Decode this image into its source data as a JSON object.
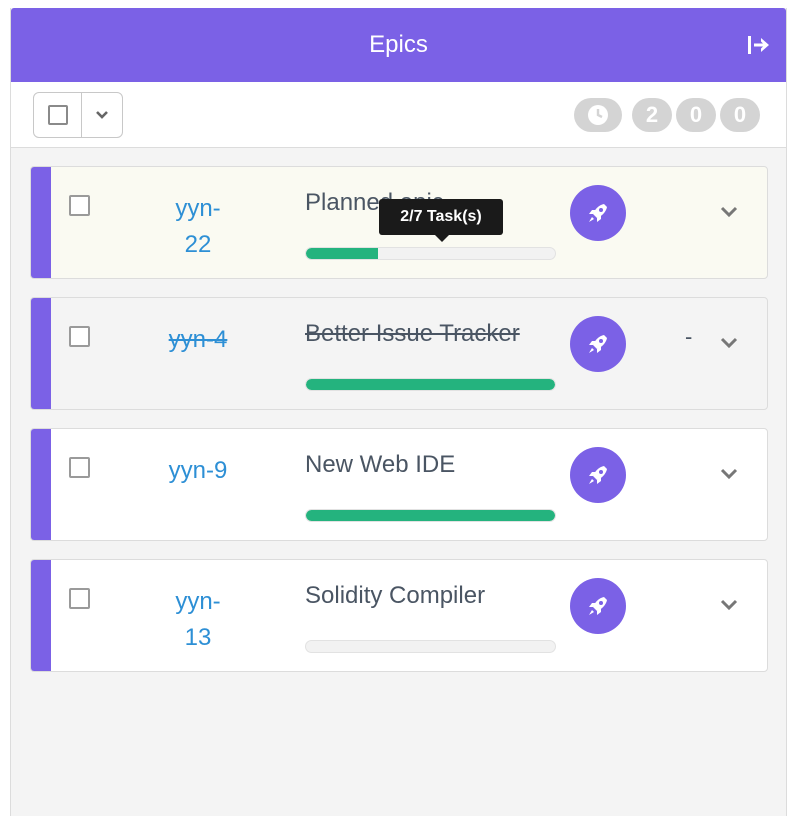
{
  "header": {
    "title": "Epics",
    "exit_icon": "sign-out-icon"
  },
  "toolbar": {
    "counters": [
      "2",
      "0",
      "0"
    ],
    "clock_icon": "clock-icon"
  },
  "tooltip": {
    "text": "2/7 Task(s)"
  },
  "epics": [
    {
      "key": "yyn-22",
      "title": "Planned epic",
      "progress": 0.29,
      "done": false,
      "highlight": true,
      "dash": ""
    },
    {
      "key": "yyn-4",
      "title": "Better Issue Tracker",
      "progress": 1.0,
      "done": true,
      "highlight": false,
      "dash": "-"
    },
    {
      "key": "yyn-9",
      "title": "New Web IDE",
      "progress": 1.0,
      "done": false,
      "highlight": false,
      "dash": ""
    },
    {
      "key": "yyn-13",
      "title": "Solidity Compiler",
      "progress": 0.0,
      "done": false,
      "highlight": false,
      "dash": ""
    }
  ],
  "colors": {
    "accent": "#7b61e6",
    "link": "#2d8fd5",
    "progress": "#24b37e"
  }
}
